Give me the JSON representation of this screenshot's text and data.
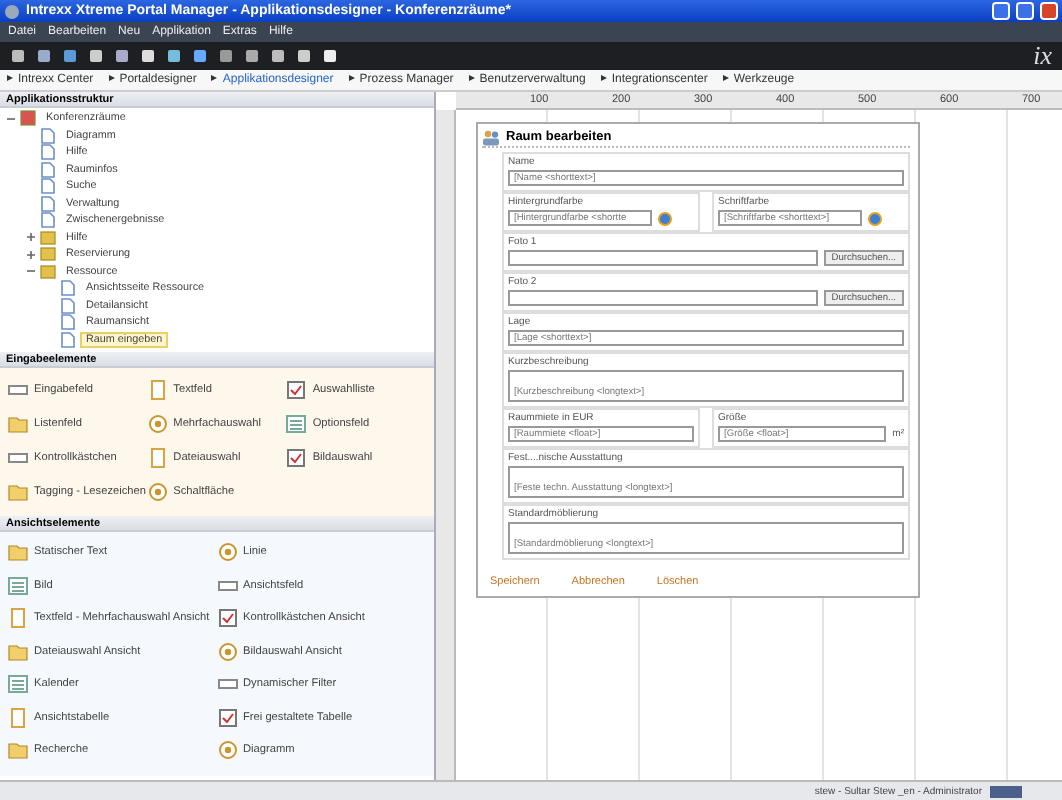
{
  "window": {
    "title": "Intrexx Xtreme Portal Manager - Applikationsdesigner - Konferenzräume*"
  },
  "menu": [
    "Datei",
    "Bearbeiten",
    "Neu",
    "Applikation",
    "Extras",
    "Hilfe"
  ],
  "logo": "ix",
  "nav": [
    {
      "label": "Intrexx Center",
      "selected": false
    },
    {
      "label": "Portaldesigner",
      "selected": false
    },
    {
      "label": "Applikationsdesigner",
      "selected": true
    },
    {
      "label": "Prozess Manager",
      "selected": false
    },
    {
      "label": "Benutzerverwaltung",
      "selected": false
    },
    {
      "label": "Integrationscenter",
      "selected": false
    },
    {
      "label": "Werkzeuge",
      "selected": false
    }
  ],
  "structure": {
    "title": "Applikationsstruktur",
    "tree": [
      {
        "label": "Konferenzräume",
        "kind": "app",
        "expanded": true,
        "selected": false,
        "children": [
          {
            "label": "Diagramm",
            "kind": "page",
            "selected": false
          },
          {
            "label": "Hilfe",
            "kind": "page",
            "selected": false
          },
          {
            "label": "Rauminfos",
            "kind": "page",
            "selected": false
          },
          {
            "label": "Suche",
            "kind": "page",
            "selected": false
          },
          {
            "label": "Verwaltung",
            "kind": "page",
            "selected": false
          },
          {
            "label": "Zwischenergebnisse",
            "kind": "page",
            "selected": false
          },
          {
            "label": "Hilfe",
            "kind": "group",
            "expanded": false,
            "selected": false
          },
          {
            "label": "Reservierung",
            "kind": "group",
            "expanded": false,
            "selected": false
          },
          {
            "label": "Ressource",
            "kind": "group",
            "expanded": true,
            "selected": false,
            "children": [
              {
                "label": "Ansichtsseite Ressource",
                "kind": "page",
                "selected": false
              },
              {
                "label": "Detailansicht",
                "kind": "page",
                "selected": false
              },
              {
                "label": "Raumansicht",
                "kind": "page",
                "selected": false
              },
              {
                "label": "Raum eingeben",
                "kind": "page",
                "selected": true
              }
            ]
          }
        ]
      }
    ]
  },
  "input_elements": {
    "title": "Eingabeelemente",
    "items": [
      "Eingabefeld",
      "Textfeld",
      "Auswahlliste",
      "Listenfeld",
      "Mehrfachauswahl",
      "Optionsfeld",
      "Kontrollkästchen",
      "Dateiauswahl",
      "Bildauswahl",
      "Tagging - Lesezeichen",
      "Schaltfläche"
    ]
  },
  "view_elements": {
    "title": "Ansichtselemente",
    "items": [
      "Statischer Text",
      "Linie",
      "Bild",
      "Ansichtsfeld",
      "Textfeld - Mehrfachauswahl Ansicht",
      "Kontrollkästchen Ansicht",
      "Dateiauswahl Ansicht",
      "Bildauswahl Ansicht",
      "Kalender",
      "Dynamischer Filter",
      "Ansichtstabelle",
      "Frei gestaltete Tabelle",
      "Recherche",
      "Diagramm"
    ]
  },
  "ruler": {
    "labels": [
      "100",
      "200",
      "300",
      "400",
      "500",
      "600",
      "700"
    ]
  },
  "form": {
    "title": "Raum bearbeiten",
    "rows": [
      [
        {
          "label": "Name",
          "kind": "text",
          "value": "[Name <shorttext>]"
        }
      ],
      [
        {
          "label": "Hintergrundfarbe",
          "kind": "color",
          "value": "[Hintergrundfarbe <shortte"
        },
        {
          "label": "Schriftfarbe",
          "kind": "color",
          "value": "[Schriftfarbe <shorttext>]"
        }
      ],
      [
        {
          "label": "Foto 1",
          "kind": "file",
          "button": "Durchsuchen..."
        }
      ],
      [
        {
          "label": "Foto 2",
          "kind": "file",
          "button": "Durchsuchen..."
        }
      ],
      [
        {
          "label": "Lage",
          "kind": "text",
          "value": "[Lage <shorttext>]"
        }
      ],
      [
        {
          "label": "Kurzbeschreibung",
          "kind": "textarea",
          "value": "[Kurzbeschreibung <longtext>]"
        }
      ],
      [
        {
          "label": "Raummiete in EUR",
          "kind": "text",
          "value": "[Raummiete <float>]"
        },
        {
          "label": "Größe",
          "kind": "text",
          "value": "[Größe <float>]",
          "unit": "m²"
        }
      ],
      [
        {
          "label": "Fest....nische Ausstattung",
          "kind": "textarea",
          "value": "[Feste techn. Ausstattung <longtext>]"
        }
      ],
      [
        {
          "label": "Standardmöblierung",
          "kind": "textarea",
          "value": "[Standardmöblierung <longtext>]"
        }
      ]
    ],
    "actions": [
      "Speichern",
      "Abbrechen",
      "Löschen"
    ]
  },
  "status_bar": {
    "text": "stew - Sultar Stew _en - Administrator"
  }
}
